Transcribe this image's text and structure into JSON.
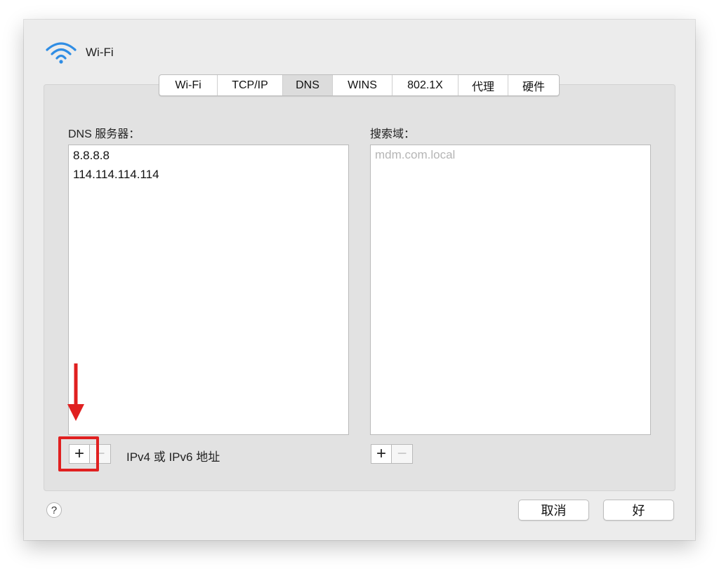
{
  "window": {
    "title": "Wi-Fi",
    "icon": "wifi-icon"
  },
  "tabs": [
    {
      "label": "Wi-Fi",
      "active": false
    },
    {
      "label": "TCP/IP",
      "active": false
    },
    {
      "label": "DNS",
      "active": true
    },
    {
      "label": "WINS",
      "active": false
    },
    {
      "label": "802.1X",
      "active": false
    },
    {
      "label": "代理",
      "active": false
    },
    {
      "label": "硬件",
      "active": false
    }
  ],
  "dns": {
    "label": "DNS 服务器：",
    "servers": [
      "8.8.8.8",
      "114.114.114.114"
    ],
    "add_label": "+",
    "remove_label": "−",
    "hint": "IPv4 或 IPv6 地址"
  },
  "search": {
    "label": "搜索域：",
    "placeholder": "mdm.com.local",
    "add_label": "+",
    "remove_label": "−"
  },
  "footer": {
    "help_label": "?",
    "cancel_label": "取消",
    "ok_label": "好"
  },
  "annotation": {
    "color": "#e02020"
  }
}
